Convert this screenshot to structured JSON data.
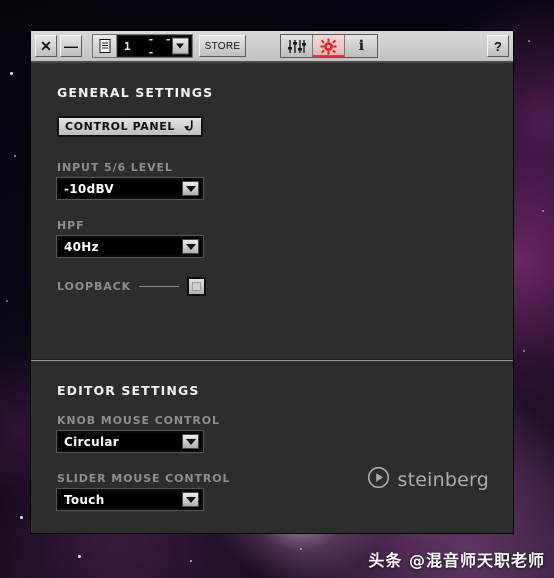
{
  "window": {
    "toolbar": {
      "close_label": "✕",
      "minimize_label": "—",
      "file_icon": "document-icon",
      "preset_number": "1",
      "preset_name": "- - -",
      "store_label": "STORE",
      "mode_buttons": [
        {
          "name": "mixer-faders",
          "label": "",
          "active": false
        },
        {
          "name": "settings-gear",
          "label": "",
          "active": true
        },
        {
          "name": "info",
          "label": "i",
          "active": false
        }
      ],
      "help_label": "?"
    },
    "general": {
      "title": "GENERAL SETTINGS",
      "control_panel_label": "CONTROL PANEL",
      "input_level_label": "INPUT 5/6 LEVEL",
      "input_level_value": "-10dBV",
      "hpf_label": "HPF",
      "hpf_value": "40Hz",
      "loopback_label": "LOOPBACK",
      "loopback_state": "off"
    },
    "editor": {
      "title": "EDITOR SETTINGS",
      "knob_mouse_label": "KNOB MOUSE CONTROL",
      "knob_mouse_value": "Circular",
      "slider_mouse_label": "SLIDER MOUSE CONTROL",
      "slider_mouse_value": "Touch"
    },
    "brand": {
      "name": "steinberg"
    }
  },
  "overlay": {
    "watermark": "头条 @混音师天职老师"
  },
  "colors": {
    "accent_red": "#e03a3a",
    "panel_bg": "#2d2d2d",
    "toolbar_bg": "#c9c9c9",
    "label_gray": "#8e8e8e"
  }
}
